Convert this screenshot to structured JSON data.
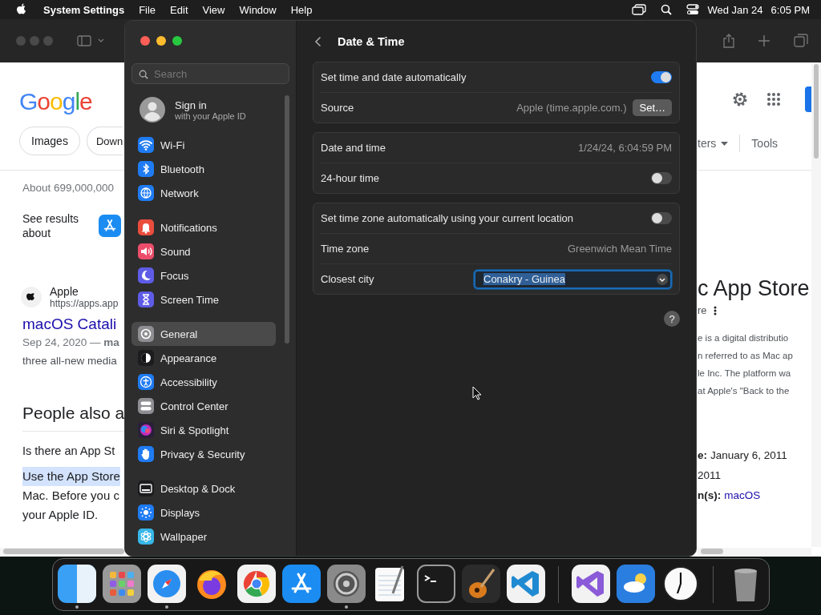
{
  "menubar": {
    "app_name": "System Settings",
    "menus": [
      "File",
      "Edit",
      "View",
      "Window",
      "Help"
    ],
    "date": "Wed Jan 24",
    "time": "6:05 PM"
  },
  "browser": {
    "left": {
      "logo": "Google",
      "chips": [
        "Images",
        "Down"
      ],
      "result_count": "About 699,000,000",
      "see_results": "See results about",
      "site_name": "Apple",
      "site_url": "https://apps.app",
      "result_title": "macOS Catali",
      "snippet": [
        "Sep 24, 2020 — **ma**",
        "three all-new media"
      ],
      "paa_heading": "People also a",
      "question": "Is there an App St",
      "answer": [
        {
          "text": "Use the App Store",
          "highlighted": true
        },
        {
          "text": "Mac. Before you c",
          "highlighted": false
        },
        {
          "text": "your Apple ID.",
          "highlighted": false
        }
      ]
    },
    "right": {
      "filter": "ters",
      "tools": "Tools",
      "kp_title": "c App Store",
      "kp_subtitle": "re",
      "kp_text": [
        "e is a digital distributio",
        "n referred to as Mac ap",
        "le Inc. The platform wa",
        "at Apple's \"Back to the"
      ],
      "facts": [
        {
          "label": "e:",
          "value": "January 6, 2011",
          "link": false
        },
        {
          "value": "2011",
          "link": false
        },
        {
          "label": "n(s):",
          "value": "macOS",
          "link": true
        }
      ]
    }
  },
  "settings": {
    "search": {
      "placeholder": "Search"
    },
    "account": {
      "title": "Sign in",
      "subtitle": "with your Apple ID"
    },
    "groups": [
      {
        "items": [
          {
            "label": "Wi-Fi",
            "kind": "wifi",
            "color": "#1f7bf2",
            "selected": false
          },
          {
            "label": "Bluetooth",
            "kind": "bluetooth",
            "color": "#1f7bf2",
            "selected": false
          },
          {
            "label": "Network",
            "kind": "globe",
            "color": "#1f7bf2",
            "selected": false
          }
        ]
      },
      {
        "items": [
          {
            "label": "Notifications",
            "kind": "bell",
            "color": "#eb4d3d",
            "selected": false
          },
          {
            "label": "Sound",
            "kind": "speaker",
            "color": "#eb4d6a",
            "selected": false
          },
          {
            "label": "Focus",
            "kind": "moon",
            "color": "#5e5ce6",
            "selected": false
          },
          {
            "label": "Screen Time",
            "kind": "hourglass",
            "color": "#5e5ce6",
            "selected": false
          }
        ]
      },
      {
        "items": [
          {
            "label": "General",
            "kind": "gear",
            "color": "#8e8e93",
            "selected": true
          },
          {
            "label": "Appearance",
            "kind": "contrast",
            "color": "#1c1c1e",
            "selected": false
          },
          {
            "label": "Accessibility",
            "kind": "accessibility",
            "color": "#1f7bf2",
            "selected": false
          },
          {
            "label": "Control Center",
            "kind": "toggles",
            "color": "#8e8e93",
            "selected": false
          },
          {
            "label": "Siri & Spotlight",
            "kind": "orb",
            "color": "#2a1f3a",
            "selected": false
          },
          {
            "label": "Privacy & Security",
            "kind": "hand",
            "color": "#1f7bf2",
            "selected": false
          }
        ]
      },
      {
        "items": [
          {
            "label": "Desktop & Dock",
            "kind": "dock",
            "color": "#1c1c1e",
            "selected": false
          },
          {
            "label": "Displays",
            "kind": "sun",
            "color": "#1f7bf2",
            "selected": false
          },
          {
            "label": "Wallpaper",
            "kind": "flower",
            "color": "#38b6e8",
            "selected": false
          }
        ]
      }
    ],
    "page": {
      "title": "Date & Time",
      "sections": [
        {
          "rows": [
            {
              "kind": "toggle",
              "label": "Set time and date automatically",
              "on": true
            },
            {
              "kind": "value_button",
              "label": "Source",
              "value": "Apple (time.apple.com.)",
              "button": "Set…"
            }
          ]
        },
        {
          "rows": [
            {
              "kind": "value",
              "label": "Date and time",
              "value": "1/24/24, 6:04:59 PM"
            },
            {
              "kind": "toggle",
              "label": "24-hour time",
              "on": false
            }
          ]
        },
        {
          "rows": [
            {
              "kind": "toggle",
              "label": "Set time zone automatically using your current location",
              "on": false
            },
            {
              "kind": "value",
              "label": "Time zone",
              "value": "Greenwich Mean Time"
            },
            {
              "kind": "popup",
              "label": "Closest city",
              "value": "Conakry - Guinea",
              "focused": true
            }
          ]
        }
      ],
      "help": "?"
    }
  },
  "dock": [
    {
      "kind": "finder",
      "running": true
    },
    {
      "kind": "launchpad",
      "running": false
    },
    {
      "kind": "safari",
      "running": true
    },
    {
      "kind": "firefox",
      "running": false
    },
    {
      "kind": "chrome",
      "running": false
    },
    {
      "kind": "appstore",
      "running": false
    },
    {
      "kind": "settings",
      "running": true
    },
    {
      "kind": "textedit",
      "running": false
    },
    {
      "kind": "terminal",
      "running": false
    },
    {
      "kind": "garageband",
      "running": false
    },
    {
      "kind": "vscode",
      "running": false
    },
    {
      "kind": "divider"
    },
    {
      "kind": "visualstudio",
      "running": false
    },
    {
      "kind": "weather",
      "running": false
    },
    {
      "kind": "clock",
      "running": false
    },
    {
      "kind": "divider"
    },
    {
      "kind": "trash",
      "running": false
    }
  ]
}
